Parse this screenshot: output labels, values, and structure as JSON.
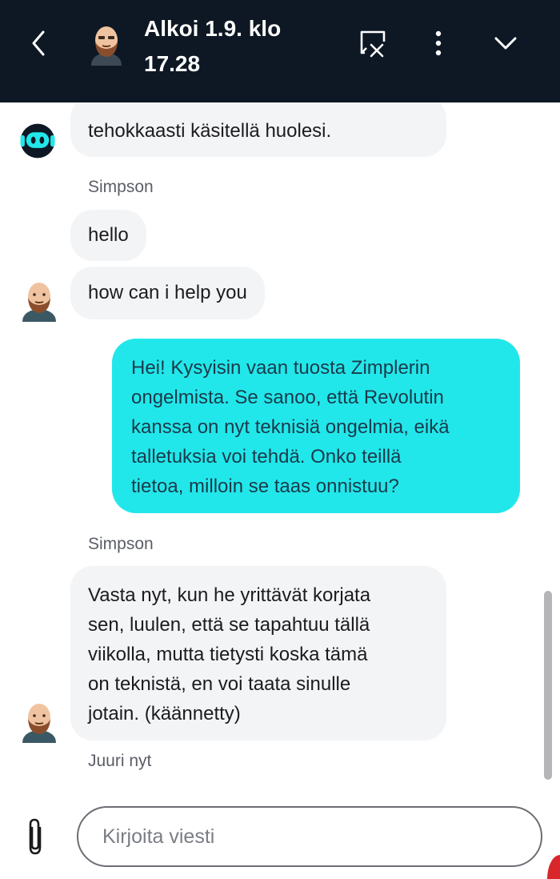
{
  "header": {
    "title_line1": "Alkoi 1.9. klo",
    "title_line2": "17.28",
    "back_icon": "chevron-left-icon",
    "end_chat_icon": "end-chat-icon",
    "more_icon": "more-vertical-icon",
    "minimize_icon": "chevron-down-icon"
  },
  "messages": {
    "bot_partial": "tehokkaasti käsitellä huolesi.",
    "sender1": "Simpson",
    "agent_msg1": "hello",
    "agent_msg2": "how can i help you",
    "user_lines": [
      "Hei! Kysyisin vaan tuosta Zimplerin",
      "ongelmista. Se sanoo, että Revolutin",
      "kanssa on nyt teknisiä ongelmia, eikä",
      "talletuksia voi tehdä. Onko teillä",
      "tietoa, milloin se taas onnistuu?"
    ],
    "sender2": "Simpson",
    "agent_lines": [
      "Vasta nyt, kun he yrittävät korjata",
      "sen, luulen, että se tapahtuu tällä",
      "viikolla, mutta tietysti koska tämä",
      "on teknistä, en voi taata sinulle",
      "jotain.  (käännetty)"
    ],
    "timestamp": "Juuri nyt"
  },
  "composer": {
    "placeholder": "Kirjoita viesti",
    "attach_icon": "paperclip-icon"
  },
  "colors": {
    "header_bg": "#0d1824",
    "user_bubble": "#22e7ea",
    "agent_bubble": "#f3f4f6"
  }
}
